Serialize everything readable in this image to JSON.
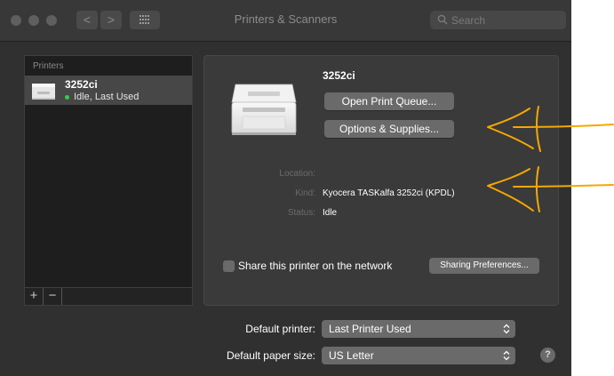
{
  "window": {
    "title": "Printers & Scanners",
    "search_placeholder": "Search"
  },
  "toolbar": {
    "back_glyph": "<",
    "forward_glyph": ">",
    "grid_icon": "grid-icon"
  },
  "printers": {
    "header": "Printers",
    "items": [
      {
        "name": "3252ci",
        "status": "Idle, Last Used",
        "status_color": "#3cc84b"
      }
    ],
    "add_label": "+",
    "remove_label": "−"
  },
  "detail": {
    "name": "3252ci",
    "open_queue_label": "Open Print Queue...",
    "options_label": "Options & Supplies...",
    "location_label": "Location:",
    "location_value": "",
    "kind_label": "Kind:",
    "kind_value": "Kyocera TASKalfa 3252ci (KPDL)",
    "status_label": "Status:",
    "status_value": "Idle",
    "share_label": "Share this printer on the network",
    "share_checked": false,
    "sharing_prefs_label": "Sharing Preferences..."
  },
  "defaults": {
    "printer_label": "Default printer:",
    "printer_value": "Last Printer Used",
    "paper_label": "Default paper size:",
    "paper_value": "US Letter"
  },
  "help_label": "?",
  "annotation_color": "#f5a800",
  "colors": {
    "window_bg": "#303030",
    "button_bg": "#6a6a6a",
    "selected_row": "#474747"
  }
}
